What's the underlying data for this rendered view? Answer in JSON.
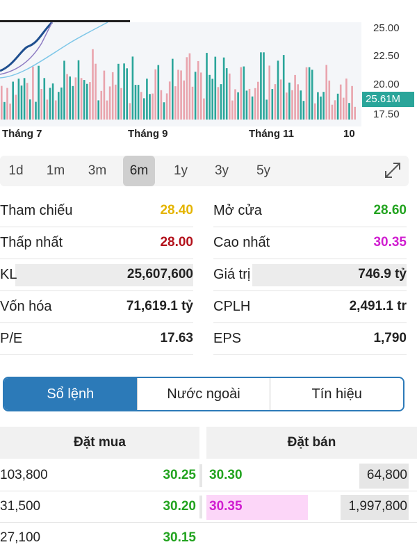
{
  "chart": {
    "y_labels": [
      "25.00",
      "22.50",
      "20.00",
      "17.50"
    ],
    "volume_badge": "25.61M",
    "x_labels": [
      "Tháng 7",
      "Tháng 9",
      "Tháng 11",
      "10"
    ],
    "colors": {
      "up": "#2aa59a",
      "down": "#e9a4ad",
      "price": "#1f4f8f",
      "ma": "#8e7cc3",
      "ma2": "#7fc7e8"
    }
  },
  "ranges": [
    "1d",
    "1m",
    "3m",
    "6m",
    "1y",
    "3y",
    "5y"
  ],
  "active_range": "6m",
  "stats": {
    "rows": [
      {
        "left_label": "Tham chiếu",
        "left_value": "28.40",
        "right_label": "Mở cửa",
        "right_value": "28.60"
      },
      {
        "left_label": "Thấp nhất",
        "left_value": "28.00",
        "right_label": "Cao nhất",
        "right_value": "30.35"
      },
      {
        "left_label": "KL",
        "left_value": "25,607,600",
        "right_label": "Giá trị",
        "right_value": "746.9 tỷ"
      },
      {
        "left_label": "Vốn hóa",
        "left_value": "71,619.1 tỷ",
        "right_label": "CPLH",
        "right_value": "2,491.1 tr"
      },
      {
        "left_label": "P/E",
        "left_value": "17.63",
        "right_label": "EPS",
        "right_value": "1,790"
      }
    ]
  },
  "tabs": [
    "Sổ lệnh",
    "Nước ngoài",
    "Tín hiệu"
  ],
  "active_tab": "Sổ lệnh",
  "orderbook": {
    "buy_header": "Đặt mua",
    "sell_header": "Đặt bán",
    "rows": [
      {
        "buy_vol": "103,800",
        "buy_price": "30.25",
        "sell_price": "30.30",
        "sell_vol": "64,800"
      },
      {
        "buy_vol": "31,500",
        "buy_price": "30.20",
        "sell_price": "30.35",
        "sell_vol": "1,997,800"
      },
      {
        "buy_vol": "27,100",
        "buy_price": "30.15",
        "sell_price": "",
        "sell_vol": ""
      }
    ]
  }
}
